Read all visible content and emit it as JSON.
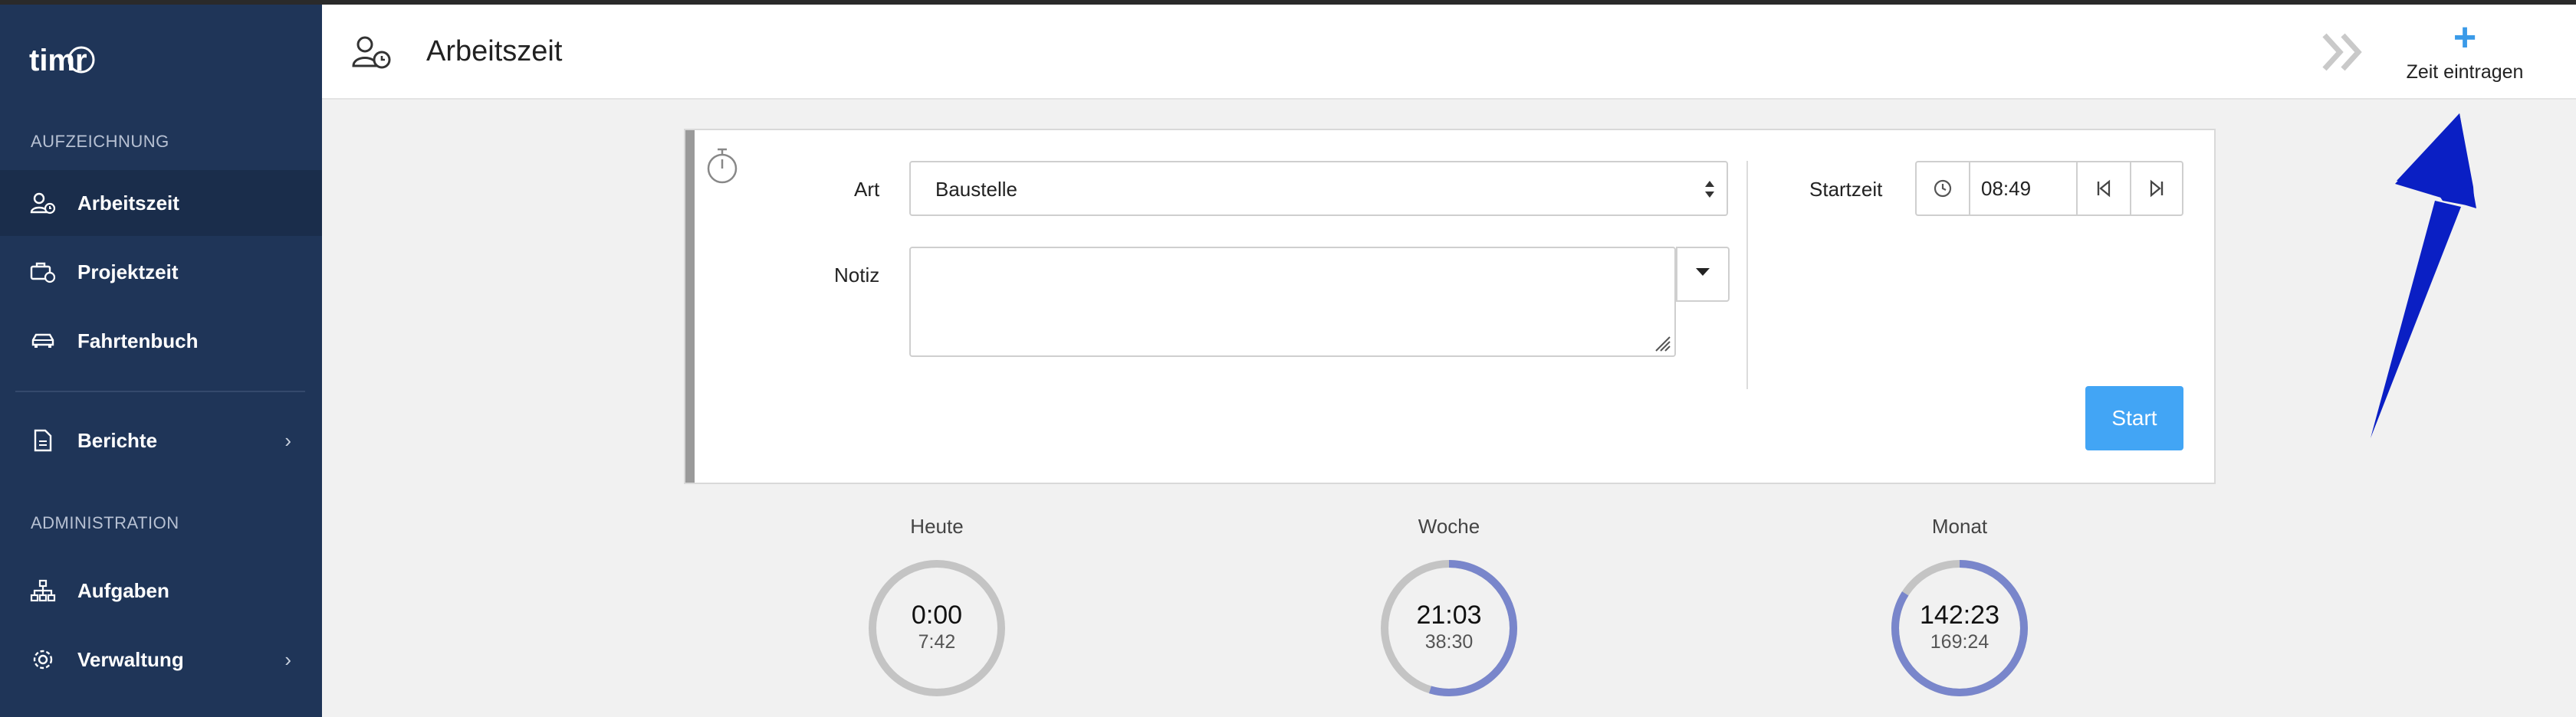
{
  "sidebar": {
    "logo_text": "timr",
    "section_recording": "AUFZEICHNUNG",
    "items": [
      {
        "label": "Arbeitszeit"
      },
      {
        "label": "Projektzeit"
      },
      {
        "label": "Fahrtenbuch"
      },
      {
        "label": "Berichte"
      },
      {
        "label": "Aufgaben"
      },
      {
        "label": "Verwaltung"
      }
    ],
    "section_admin": "ADMINISTRATION"
  },
  "header": {
    "title": "Arbeitszeit",
    "add_time_label": "Zeit eintragen",
    "add_time_icon": "+"
  },
  "form": {
    "type_label": "Art",
    "type_value": "Baustelle",
    "note_label": "Notiz",
    "note_value": "",
    "start_label": "Startzeit",
    "start_time": "08:49",
    "start_button": "Start"
  },
  "stats": [
    {
      "title": "Heute",
      "value": "0:00",
      "target": "7:42",
      "progress": 0.0
    },
    {
      "title": "Woche",
      "value": "21:03",
      "target": "38:30",
      "progress": 0.547
    },
    {
      "title": "Monat",
      "value": "142:23",
      "target": "169:24",
      "progress": 0.84
    }
  ],
  "colors": {
    "sidebar_bg": "#1f3558",
    "accent": "#42a5f5",
    "ring_progress": "#7986cb",
    "ring_track": "#c4c4c4",
    "annotation_arrow": "#0a1fc4"
  }
}
